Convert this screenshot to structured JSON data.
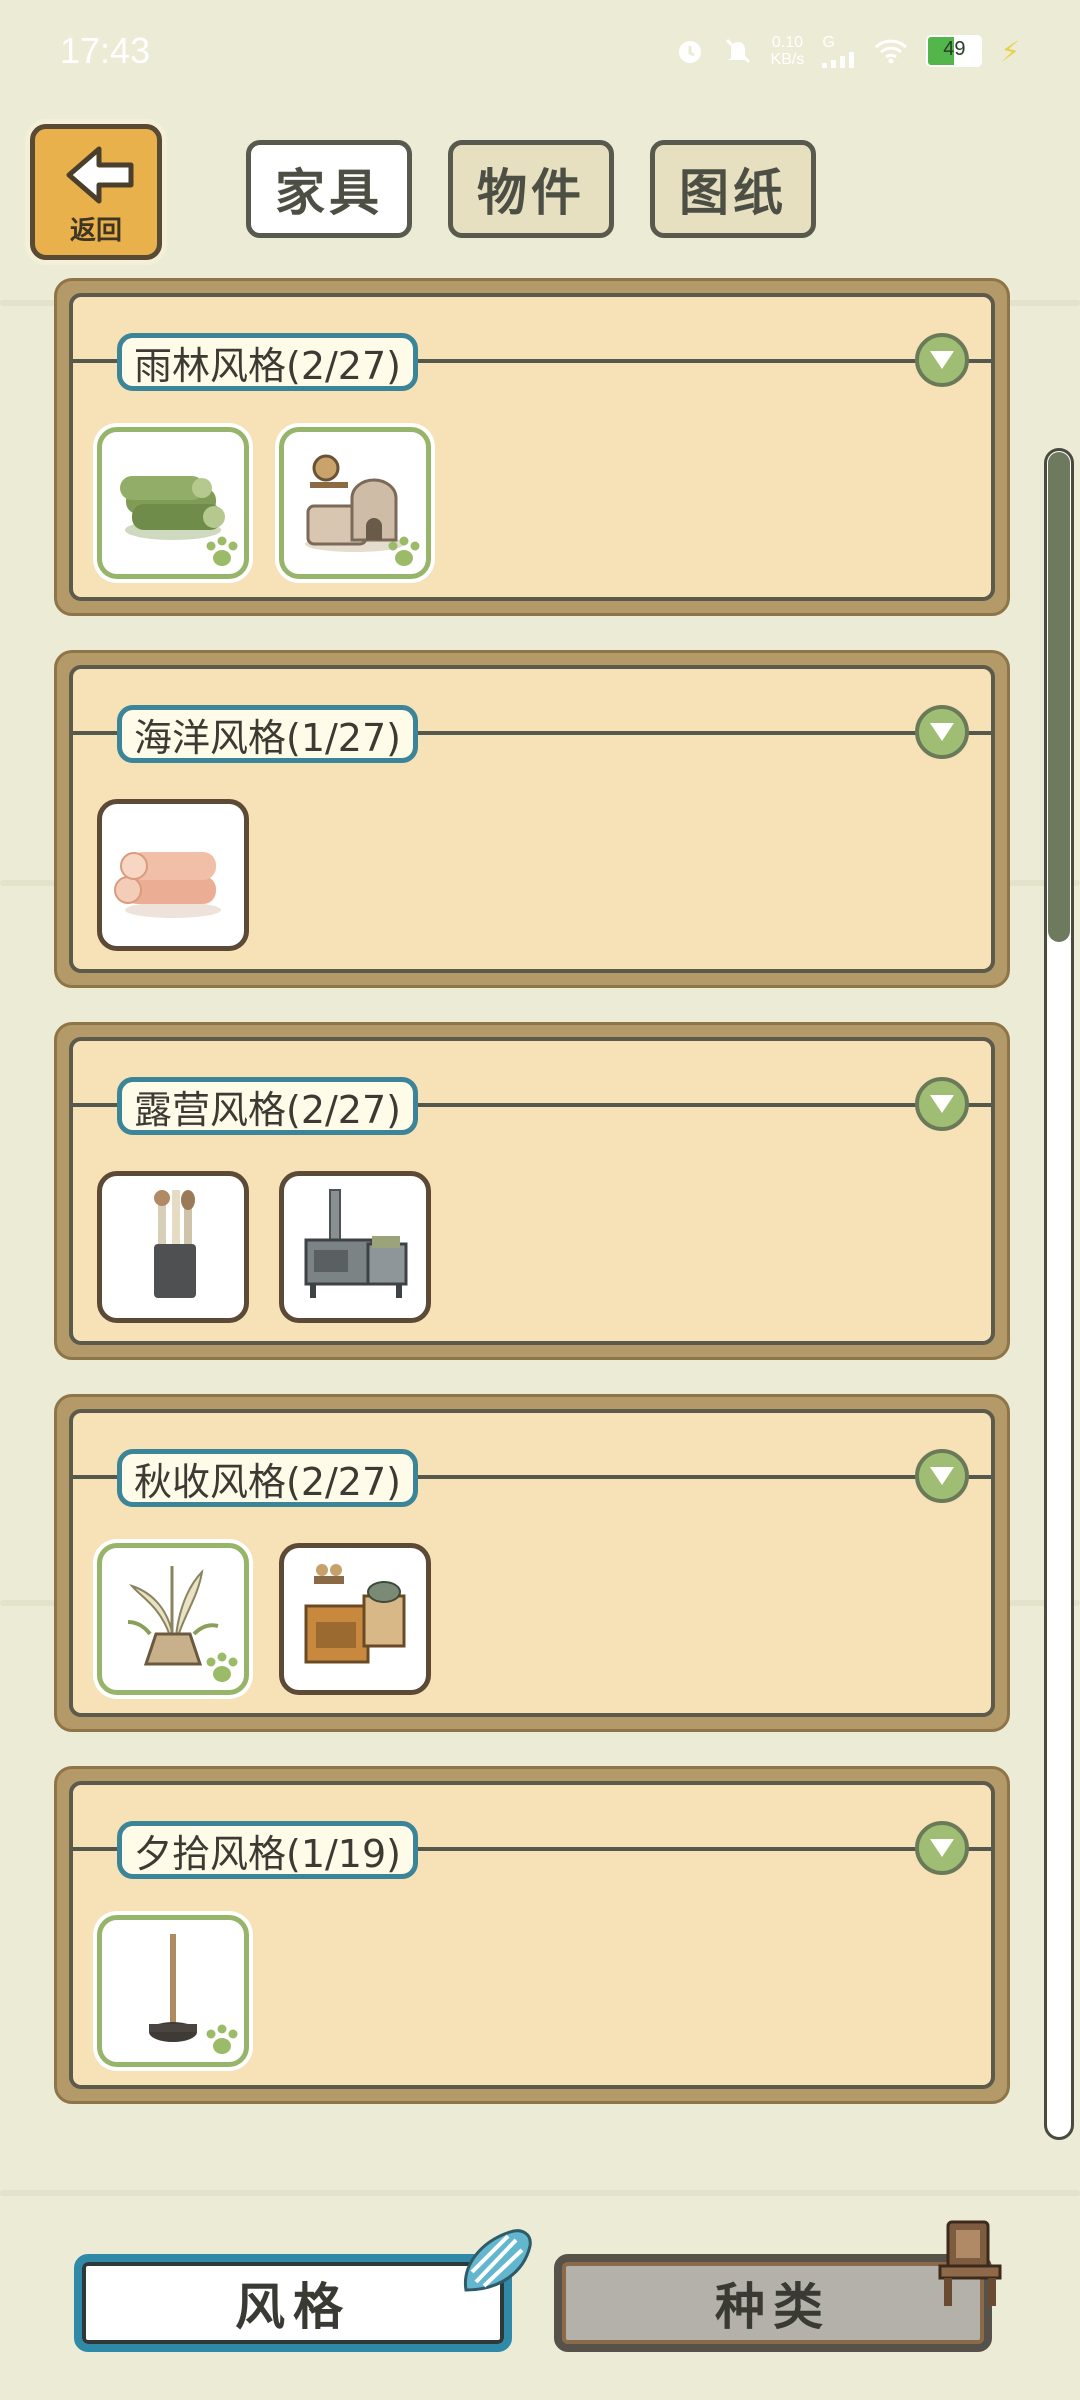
{
  "status_bar": {
    "time": "17:43",
    "net_speed_value": "0.10",
    "net_speed_unit": "KB/s",
    "network": "G",
    "battery": "49",
    "icons": [
      "alarm-icon",
      "mute-icon",
      "signal-icon",
      "wifi-icon",
      "battery-icon",
      "charging-icon"
    ]
  },
  "back_button": {
    "label": "返回"
  },
  "top_tabs": [
    {
      "label": "家具",
      "active": true
    },
    {
      "label": "物件",
      "active": false
    },
    {
      "label": "图纸",
      "active": false
    }
  ],
  "sections": [
    {
      "title": "雨林风格(2/27)",
      "items": [
        {
          "icon": "log-bundle-icon",
          "collected": true
        },
        {
          "icon": "clay-oven-icon",
          "collected": true
        }
      ]
    },
    {
      "title": "海洋风格(1/27)",
      "items": [
        {
          "icon": "rolled-towels-icon",
          "collected": false
        }
      ]
    },
    {
      "title": "露营风格(2/27)",
      "items": [
        {
          "icon": "utensil-holder-icon",
          "collected": false
        },
        {
          "icon": "camp-stove-icon",
          "collected": false
        }
      ]
    },
    {
      "title": "秋收风格(2/27)",
      "items": [
        {
          "icon": "pampas-grass-icon",
          "collected": true
        },
        {
          "icon": "wooden-stove-icon",
          "collected": false
        }
      ]
    },
    {
      "title": "夕拾风格(1/19)",
      "items": [
        {
          "icon": "pole-stand-icon",
          "collected": true
        }
      ]
    }
  ],
  "scroll": {
    "position": 0.22
  },
  "bottom_tabs": [
    {
      "label": "风格",
      "active": true,
      "icon": "shell-icon"
    },
    {
      "label": "种类",
      "active": false,
      "icon": "chair-icon"
    }
  ],
  "colors": {
    "background": "#ecebd6",
    "panel": "#f7e1b6",
    "panel_frame": "#b49a68",
    "title_border": "#3c8598",
    "collected_border": "#97b56a",
    "active_tab_border": "#2f8aa8"
  }
}
